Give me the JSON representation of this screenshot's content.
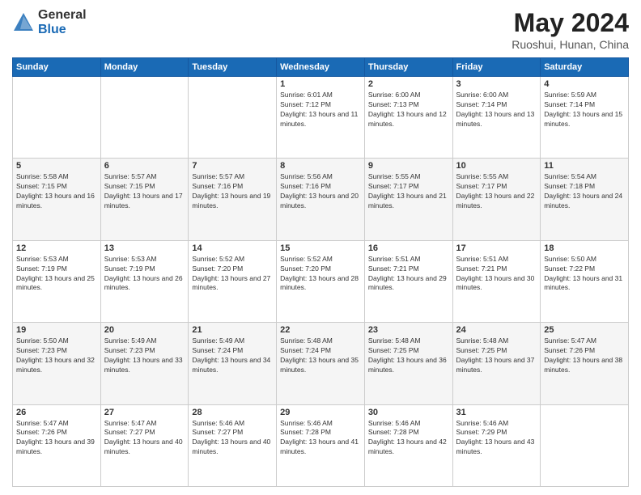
{
  "header": {
    "logo_general": "General",
    "logo_blue": "Blue",
    "title": "May 2024",
    "subtitle": "Ruoshui, Hunan, China"
  },
  "weekdays": [
    "Sunday",
    "Monday",
    "Tuesday",
    "Wednesday",
    "Thursday",
    "Friday",
    "Saturday"
  ],
  "weeks": [
    [
      {
        "day": "",
        "sunrise": "",
        "sunset": "",
        "daylight": ""
      },
      {
        "day": "",
        "sunrise": "",
        "sunset": "",
        "daylight": ""
      },
      {
        "day": "",
        "sunrise": "",
        "sunset": "",
        "daylight": ""
      },
      {
        "day": "1",
        "sunrise": "Sunrise: 6:01 AM",
        "sunset": "Sunset: 7:12 PM",
        "daylight": "Daylight: 13 hours and 11 minutes."
      },
      {
        "day": "2",
        "sunrise": "Sunrise: 6:00 AM",
        "sunset": "Sunset: 7:13 PM",
        "daylight": "Daylight: 13 hours and 12 minutes."
      },
      {
        "day": "3",
        "sunrise": "Sunrise: 6:00 AM",
        "sunset": "Sunset: 7:14 PM",
        "daylight": "Daylight: 13 hours and 13 minutes."
      },
      {
        "day": "4",
        "sunrise": "Sunrise: 5:59 AM",
        "sunset": "Sunset: 7:14 PM",
        "daylight": "Daylight: 13 hours and 15 minutes."
      }
    ],
    [
      {
        "day": "5",
        "sunrise": "Sunrise: 5:58 AM",
        "sunset": "Sunset: 7:15 PM",
        "daylight": "Daylight: 13 hours and 16 minutes."
      },
      {
        "day": "6",
        "sunrise": "Sunrise: 5:57 AM",
        "sunset": "Sunset: 7:15 PM",
        "daylight": "Daylight: 13 hours and 17 minutes."
      },
      {
        "day": "7",
        "sunrise": "Sunrise: 5:57 AM",
        "sunset": "Sunset: 7:16 PM",
        "daylight": "Daylight: 13 hours and 19 minutes."
      },
      {
        "day": "8",
        "sunrise": "Sunrise: 5:56 AM",
        "sunset": "Sunset: 7:16 PM",
        "daylight": "Daylight: 13 hours and 20 minutes."
      },
      {
        "day": "9",
        "sunrise": "Sunrise: 5:55 AM",
        "sunset": "Sunset: 7:17 PM",
        "daylight": "Daylight: 13 hours and 21 minutes."
      },
      {
        "day": "10",
        "sunrise": "Sunrise: 5:55 AM",
        "sunset": "Sunset: 7:17 PM",
        "daylight": "Daylight: 13 hours and 22 minutes."
      },
      {
        "day": "11",
        "sunrise": "Sunrise: 5:54 AM",
        "sunset": "Sunset: 7:18 PM",
        "daylight": "Daylight: 13 hours and 24 minutes."
      }
    ],
    [
      {
        "day": "12",
        "sunrise": "Sunrise: 5:53 AM",
        "sunset": "Sunset: 7:19 PM",
        "daylight": "Daylight: 13 hours and 25 minutes."
      },
      {
        "day": "13",
        "sunrise": "Sunrise: 5:53 AM",
        "sunset": "Sunset: 7:19 PM",
        "daylight": "Daylight: 13 hours and 26 minutes."
      },
      {
        "day": "14",
        "sunrise": "Sunrise: 5:52 AM",
        "sunset": "Sunset: 7:20 PM",
        "daylight": "Daylight: 13 hours and 27 minutes."
      },
      {
        "day": "15",
        "sunrise": "Sunrise: 5:52 AM",
        "sunset": "Sunset: 7:20 PM",
        "daylight": "Daylight: 13 hours and 28 minutes."
      },
      {
        "day": "16",
        "sunrise": "Sunrise: 5:51 AM",
        "sunset": "Sunset: 7:21 PM",
        "daylight": "Daylight: 13 hours and 29 minutes."
      },
      {
        "day": "17",
        "sunrise": "Sunrise: 5:51 AM",
        "sunset": "Sunset: 7:21 PM",
        "daylight": "Daylight: 13 hours and 30 minutes."
      },
      {
        "day": "18",
        "sunrise": "Sunrise: 5:50 AM",
        "sunset": "Sunset: 7:22 PM",
        "daylight": "Daylight: 13 hours and 31 minutes."
      }
    ],
    [
      {
        "day": "19",
        "sunrise": "Sunrise: 5:50 AM",
        "sunset": "Sunset: 7:23 PM",
        "daylight": "Daylight: 13 hours and 32 minutes."
      },
      {
        "day": "20",
        "sunrise": "Sunrise: 5:49 AM",
        "sunset": "Sunset: 7:23 PM",
        "daylight": "Daylight: 13 hours and 33 minutes."
      },
      {
        "day": "21",
        "sunrise": "Sunrise: 5:49 AM",
        "sunset": "Sunset: 7:24 PM",
        "daylight": "Daylight: 13 hours and 34 minutes."
      },
      {
        "day": "22",
        "sunrise": "Sunrise: 5:48 AM",
        "sunset": "Sunset: 7:24 PM",
        "daylight": "Daylight: 13 hours and 35 minutes."
      },
      {
        "day": "23",
        "sunrise": "Sunrise: 5:48 AM",
        "sunset": "Sunset: 7:25 PM",
        "daylight": "Daylight: 13 hours and 36 minutes."
      },
      {
        "day": "24",
        "sunrise": "Sunrise: 5:48 AM",
        "sunset": "Sunset: 7:25 PM",
        "daylight": "Daylight: 13 hours and 37 minutes."
      },
      {
        "day": "25",
        "sunrise": "Sunrise: 5:47 AM",
        "sunset": "Sunset: 7:26 PM",
        "daylight": "Daylight: 13 hours and 38 minutes."
      }
    ],
    [
      {
        "day": "26",
        "sunrise": "Sunrise: 5:47 AM",
        "sunset": "Sunset: 7:26 PM",
        "daylight": "Daylight: 13 hours and 39 minutes."
      },
      {
        "day": "27",
        "sunrise": "Sunrise: 5:47 AM",
        "sunset": "Sunset: 7:27 PM",
        "daylight": "Daylight: 13 hours and 40 minutes."
      },
      {
        "day": "28",
        "sunrise": "Sunrise: 5:46 AM",
        "sunset": "Sunset: 7:27 PM",
        "daylight": "Daylight: 13 hours and 40 minutes."
      },
      {
        "day": "29",
        "sunrise": "Sunrise: 5:46 AM",
        "sunset": "Sunset: 7:28 PM",
        "daylight": "Daylight: 13 hours and 41 minutes."
      },
      {
        "day": "30",
        "sunrise": "Sunrise: 5:46 AM",
        "sunset": "Sunset: 7:28 PM",
        "daylight": "Daylight: 13 hours and 42 minutes."
      },
      {
        "day": "31",
        "sunrise": "Sunrise: 5:46 AM",
        "sunset": "Sunset: 7:29 PM",
        "daylight": "Daylight: 13 hours and 43 minutes."
      },
      {
        "day": "",
        "sunrise": "",
        "sunset": "",
        "daylight": ""
      }
    ]
  ]
}
